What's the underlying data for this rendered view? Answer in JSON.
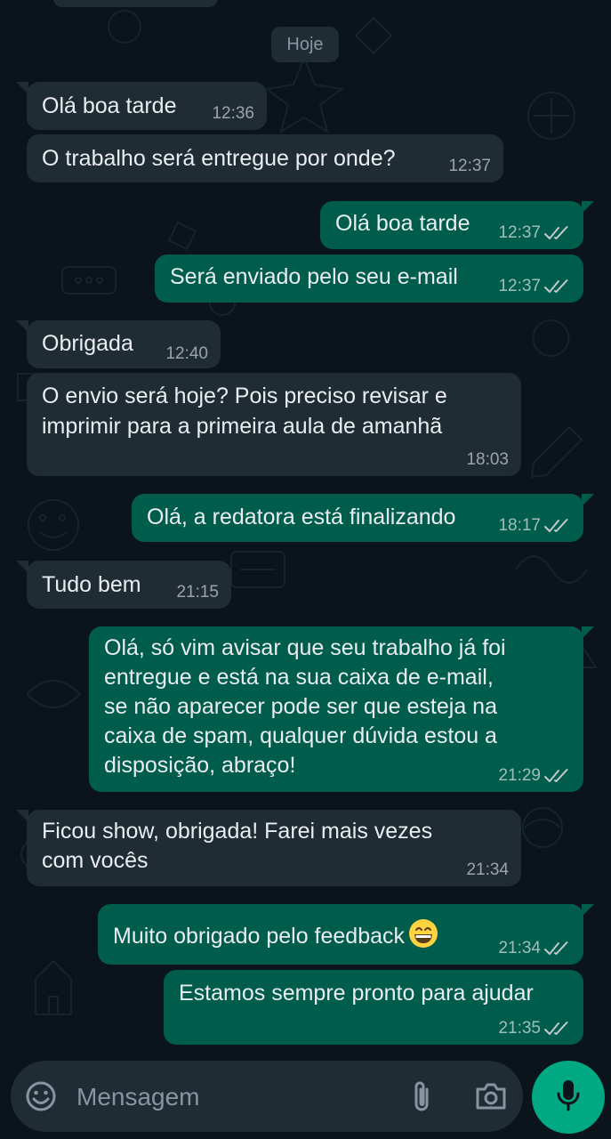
{
  "chat": {
    "date_separator": "Hoje",
    "messages": [
      {
        "dir": "in",
        "text": "Olá boa tarde",
        "time": "12:36"
      },
      {
        "dir": "in",
        "text": "O trabalho será entregue por onde?",
        "time": "12:37"
      },
      {
        "dir": "out",
        "text": "Olá boa tarde",
        "time": "12:37",
        "status": "read"
      },
      {
        "dir": "out",
        "text": "Será enviado pelo seu e-mail",
        "time": "12:37",
        "status": "read"
      },
      {
        "dir": "in",
        "text": "Obrigada",
        "time": "12:40"
      },
      {
        "dir": "in",
        "text": "O envio será hoje? Pois preciso revisar e\nimprimir para a primeira aula de amanhã",
        "time": "18:03"
      },
      {
        "dir": "out",
        "text": "Olá, a redatora está finalizando",
        "time": "18:17",
        "status": "read"
      },
      {
        "dir": "in",
        "text": "Tudo bem",
        "time": "21:15"
      },
      {
        "dir": "out",
        "text": "Olá, só vim avisar que seu trabalho já foi\nentregue e está na sua caixa de e-mail,\nse não aparecer pode ser que esteja na\ncaixa de spam, qualquer dúvida estou a\ndisposição, abraço!",
        "time": "21:29",
        "status": "read"
      },
      {
        "dir": "in",
        "text": "Ficou show, obrigada! Farei mais vezes\ncom vocês",
        "time": "21:34"
      },
      {
        "dir": "out",
        "text": "Muito obrigado pelo feedback",
        "emoji": "grinning-face",
        "time": "21:34",
        "status": "read"
      },
      {
        "dir": "out",
        "text": "Estamos sempre pronto para ajudar",
        "time": "21:35",
        "status": "read"
      }
    ]
  },
  "composer": {
    "placeholder": "Mensagem",
    "icons": [
      "emoji-icon",
      "attach-icon",
      "camera-icon",
      "mic-icon"
    ]
  },
  "colors": {
    "background": "#0b141a",
    "incoming_bubble": "#1f2c34",
    "outgoing_bubble": "#005c4b",
    "accent": "#00a884",
    "muted_text": "#8696a0"
  }
}
